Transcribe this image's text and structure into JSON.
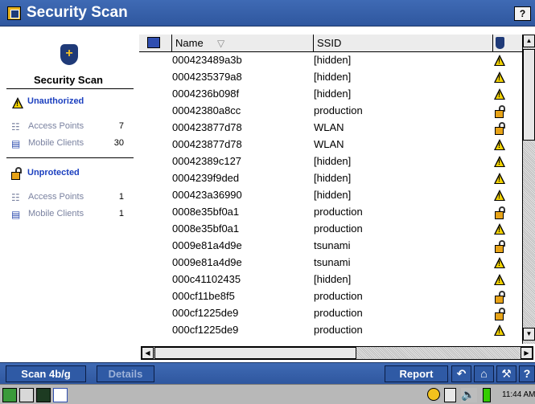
{
  "window": {
    "title": "Security Scan",
    "help_label": "?"
  },
  "sidebar": {
    "title": "Security Scan",
    "sections": [
      {
        "heading": "Unauthorized",
        "heading_icon": "warning-icon",
        "rows": [
          {
            "label": "Access Points",
            "count": "7",
            "icon": "access-point-icon"
          },
          {
            "label": "Mobile Clients",
            "count": "30",
            "icon": "mobile-client-icon"
          }
        ]
      },
      {
        "heading": "Unprotected",
        "heading_icon": "unlocked-icon",
        "rows": [
          {
            "label": "Access Points",
            "count": "1",
            "icon": "access-point-icon"
          },
          {
            "label": "Mobile Clients",
            "count": "1",
            "icon": "mobile-client-icon"
          }
        ]
      }
    ]
  },
  "table": {
    "columns": {
      "name": "Name",
      "ssid": "SSID"
    },
    "rows": [
      {
        "name": "000423489a3b",
        "ssid": "[hidden]",
        "status": "warning"
      },
      {
        "name": "0004235379a8",
        "ssid": "[hidden]",
        "status": "warning"
      },
      {
        "name": "0004236b098f",
        "ssid": "[hidden]",
        "status": "warning"
      },
      {
        "name": "00042380a8cc",
        "ssid": "production",
        "status": "unlocked"
      },
      {
        "name": "000423877d78",
        "ssid": "WLAN",
        "status": "unlocked"
      },
      {
        "name": "000423877d78",
        "ssid": "WLAN",
        "status": "warning"
      },
      {
        "name": "00042389c127",
        "ssid": "[hidden]",
        "status": "warning"
      },
      {
        "name": "0004239f9ded",
        "ssid": "[hidden]",
        "status": "warning"
      },
      {
        "name": "000423a36990",
        "ssid": "[hidden]",
        "status": "warning"
      },
      {
        "name": "0008e35bf0a1",
        "ssid": "production",
        "status": "unlocked"
      },
      {
        "name": "0008e35bf0a1",
        "ssid": "production",
        "status": "warning"
      },
      {
        "name": "0009e81a4d9e",
        "ssid": "tsunami",
        "status": "unlocked"
      },
      {
        "name": "0009e81a4d9e",
        "ssid": "tsunami",
        "status": "warning"
      },
      {
        "name": "000c41102435",
        "ssid": "[hidden]",
        "status": "warning"
      },
      {
        "name": "000cf11be8f5",
        "ssid": "production",
        "status": "unlocked"
      },
      {
        "name": "000cf1225de9",
        "ssid": "production",
        "status": "unlocked"
      },
      {
        "name": "000cf1225de9",
        "ssid": "production",
        "status": "warning"
      }
    ]
  },
  "toolbar": {
    "scan_label": "Scan 4b/g",
    "details_label": "Details",
    "report_label": "Report",
    "help_label": "?"
  },
  "taskbar": {
    "clock": "11:44 AM"
  },
  "colors": {
    "titlebar": "#3560a8",
    "heading_blue": "#1b3fbf",
    "warning": "#f2d200",
    "lock": "#e7a318"
  }
}
